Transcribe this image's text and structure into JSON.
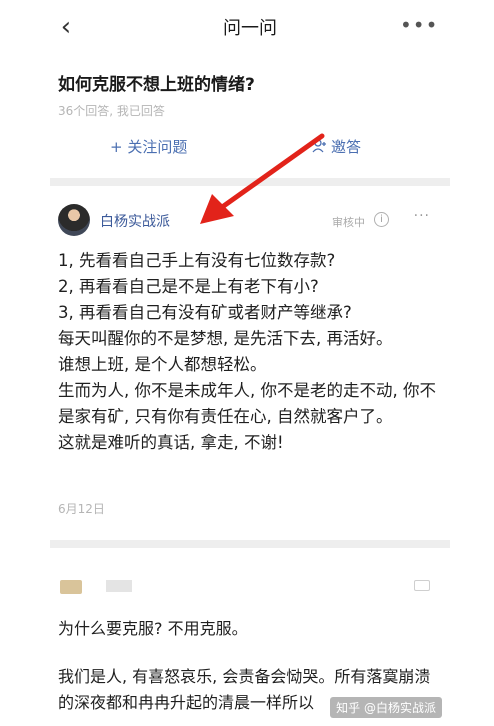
{
  "nav": {
    "back_icon": "chevron-left-icon",
    "back_glyph": "‹",
    "title": "问一问",
    "more_glyph": "•••"
  },
  "question": {
    "title": "如何克服不想上班的情绪?",
    "meta": "36个回答, 我已回答",
    "follow_label": "+ 关注问题",
    "invite_label": "邀答"
  },
  "answer1": {
    "author": "白杨实战派",
    "status": "审核中",
    "info_glyph": "i",
    "more_glyph": "···",
    "lines": [
      "1, 先看看自己手上有没有七位数存款?",
      "2, 再看看自己是不是上有老下有小?",
      "3, 再看看自己有没有矿或者财产等继承?",
      "每天叫醒你的不是梦想, 是先活下去, 再活好。",
      "谁想上班, 是个人都想轻松。",
      "生而为人, 你不是未成年人, 你不是老的走不动, 你不是家有矿, 只有你有责任在心, 自然就客户了。",
      "这就是难听的真话, 拿走, 不谢!"
    ],
    "date": "6月12日"
  },
  "answer2": {
    "line1": "为什么要克服? 不用克服。",
    "line2": "我们是人, 有喜怒哀乐, 会责备会恸哭。所有落寞崩溃的深夜都和冉冉升起的清晨一样所以",
    "watermark": "知乎 @白杨实战派"
  },
  "colors": {
    "link": "#4b6fb1",
    "arrow": "#e2231a",
    "muted": "#b5b5b5"
  }
}
